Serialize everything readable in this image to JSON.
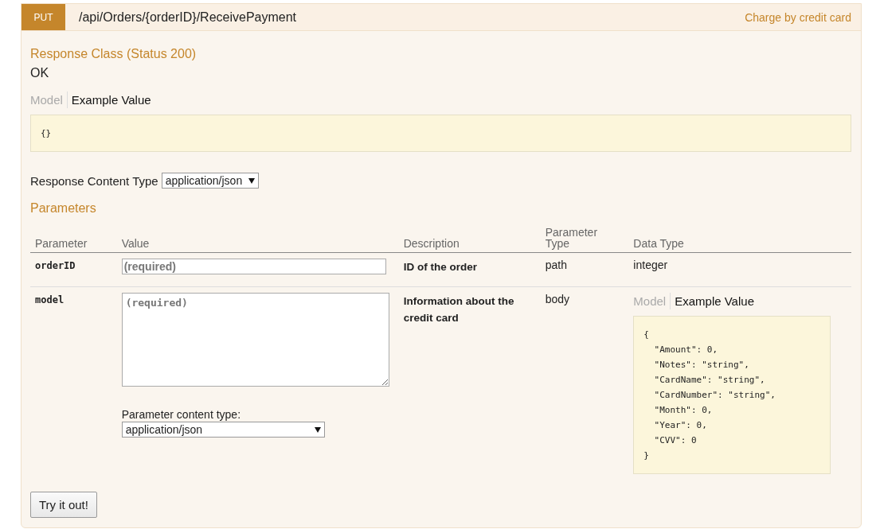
{
  "operation": {
    "method": "PUT",
    "path": "/api/Orders/{orderID}/ReceivePayment",
    "summary": "Charge by credit card"
  },
  "response_class": {
    "title": "Response Class (Status 200)",
    "message": "OK",
    "tabs": [
      {
        "label": "Model",
        "selected": false
      },
      {
        "label": "Example Value",
        "selected": true
      }
    ],
    "example": "{}"
  },
  "response_content_type": {
    "label": "Response Content Type",
    "value": "application/json"
  },
  "parameters": {
    "title": "Parameters",
    "columns": [
      "Parameter",
      "Value",
      "Description",
      "Parameter Type",
      "Data Type"
    ],
    "rows": [
      {
        "kind": "input",
        "name": "orderID",
        "placeholder": "(required)",
        "description": "ID of the order",
        "parameter_type": "path",
        "data_type": "integer"
      },
      {
        "kind": "body",
        "name": "model",
        "placeholder": "(required)",
        "description": "Information about the credit card",
        "parameter_type": "body",
        "content_type_label": "Parameter content type:",
        "content_type": "application/json",
        "tabs": [
          {
            "label": "Model",
            "selected": false
          },
          {
            "label": "Example Value",
            "selected": true
          }
        ],
        "example": "{\n  \"Amount\": 0,\n  \"Notes\": \"string\",\n  \"CardName\": \"string\",\n  \"CardNumber\": \"string\",\n  \"Month\": 0,\n  \"Year\": 0,\n  \"CVV\": 0\n}"
      }
    ]
  },
  "submit": "Try it out!"
}
